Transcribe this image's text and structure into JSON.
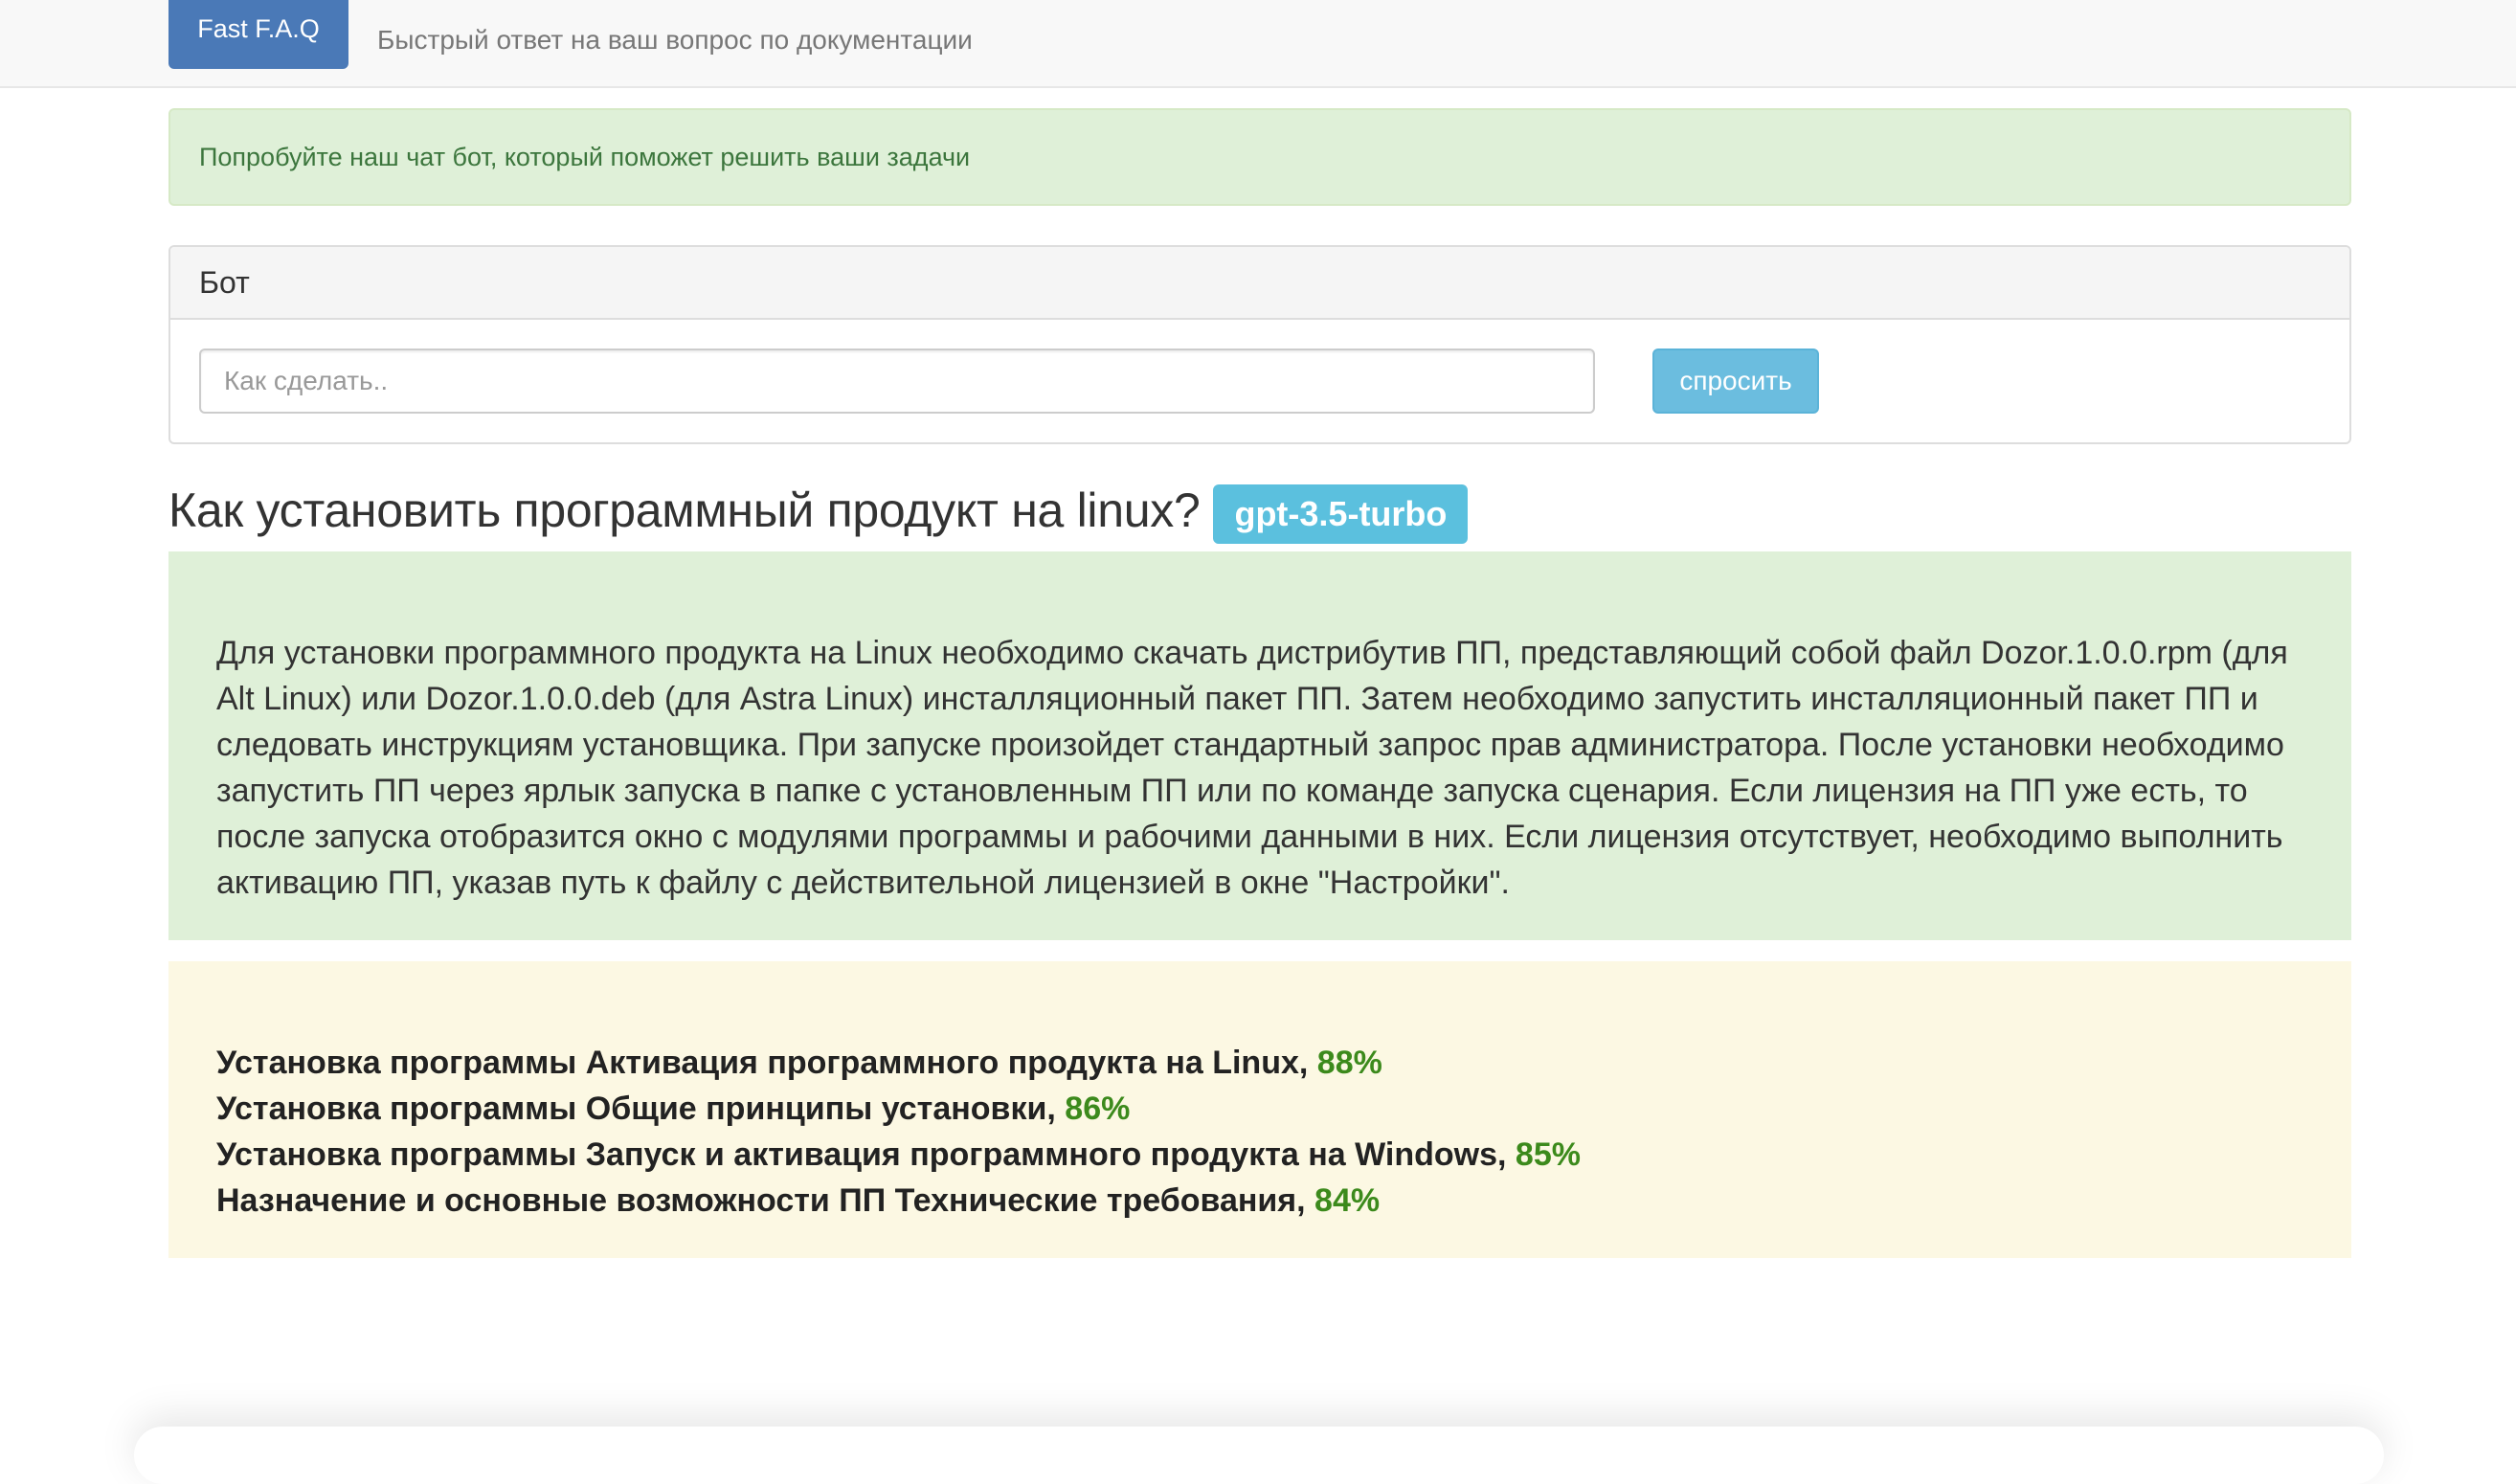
{
  "navbar": {
    "brand_label": "Fast F.A.Q",
    "tagline": "Быстрый ответ на ваш вопрос по документации"
  },
  "alert": {
    "text": "Попробуйте наш чат бот, который поможет решить ваши задачи"
  },
  "bot_panel": {
    "title": "Бот",
    "input_placeholder": "Как сделать..",
    "input_value": "",
    "ask_label": "спросить"
  },
  "question": {
    "title": "Как установить программный продукт на linux?",
    "model_badge": "gpt-3.5-turbo"
  },
  "answer": {
    "text": "Для установки программного продукта на Linux необходимо скачать дистрибутив ПП, представляющий собой файл Dozor.1.0.0.rpm (для Alt Linux) или Dozor.1.0.0.deb (для Astra Linux) инсталляционный пакет ПП. Затем необходимо запустить инсталляционный пакет ПП и следовать инструкциям установщика. При запуске произойдет стандартный запрос прав администратора. После установки необходимо запустить ПП через ярлык запуска в папке с установленным ПП или по команде запуска сценария. Если лицензия на ПП уже есть, то после запуска отобразится окно с модулями программы и рабочими данными в них. Если лицензия отсутствует, необходимо выполнить активацию ПП, указав путь к файлу с действительной лицензией в окне \"Настройки\"."
  },
  "sources": [
    {
      "title": "Установка программы Активация программного продукта на Linux",
      "separator": ", ",
      "score": "88%"
    },
    {
      "title": "Установка программы Общие принципы установки",
      "separator": ", ",
      "score": "86%"
    },
    {
      "title": "Установка программы Запуск и активация программного продукта на Windows",
      "separator": ", ",
      "score": "85%"
    },
    {
      "title": "Назначение и основные возможности ПП Технические требования",
      "separator": ", ",
      "score": "84%"
    }
  ],
  "colors": {
    "brand": "#4a79b7",
    "alert_bg": "#dff0d8",
    "alert_text": "#3c763d",
    "ask_button": "#6bbddf",
    "badge": "#5bc0de",
    "sources_bg": "#fcf8e3",
    "score_text": "#3c8a1c"
  }
}
